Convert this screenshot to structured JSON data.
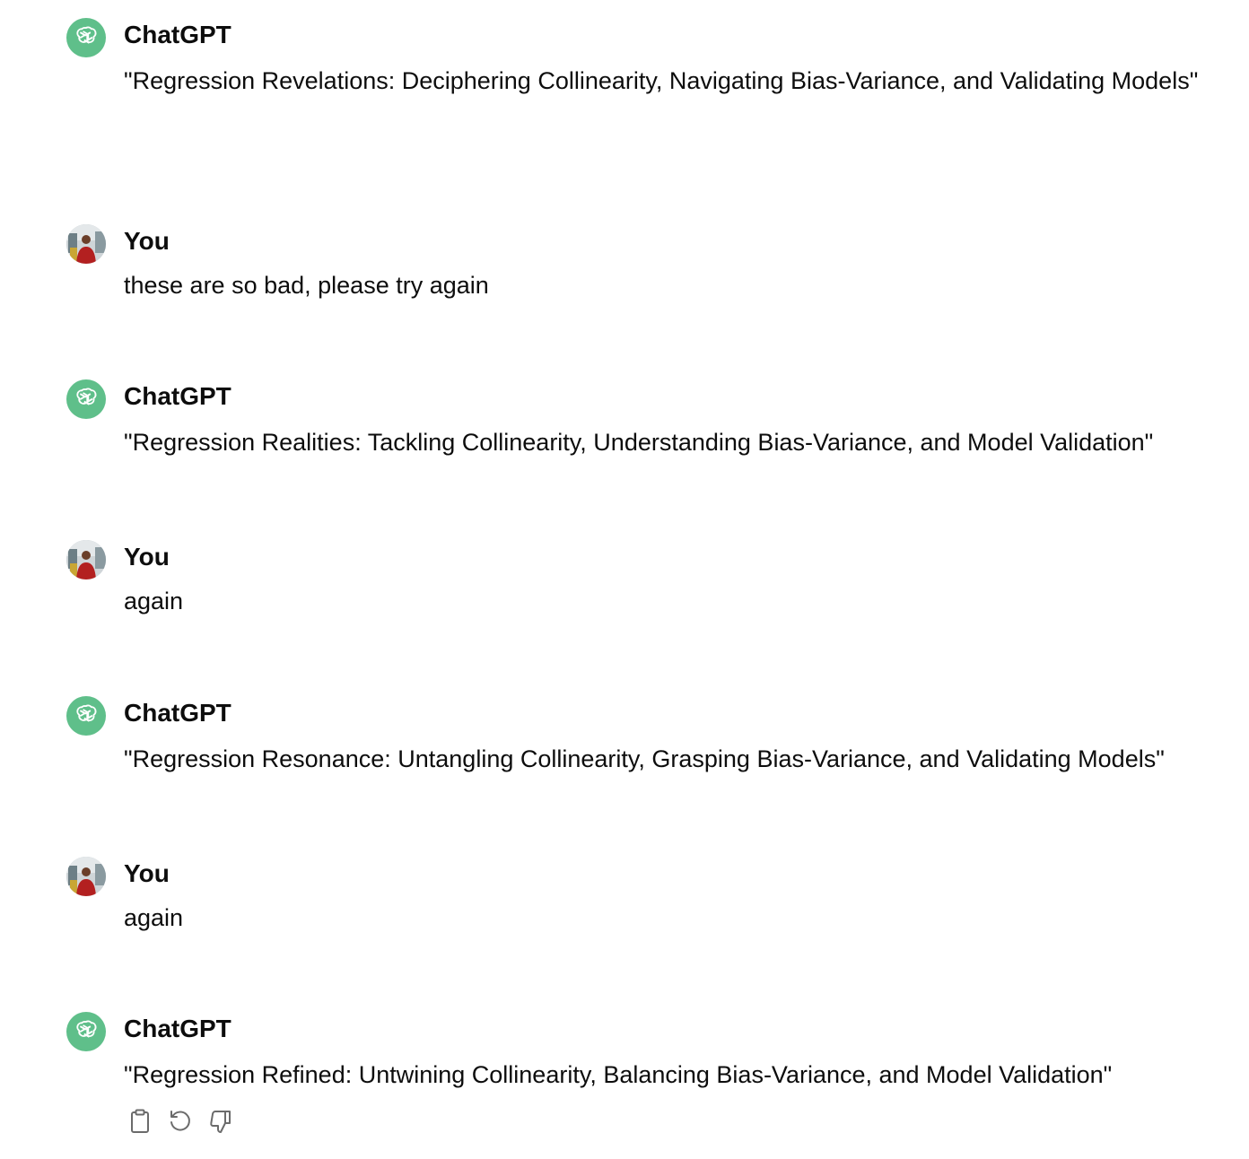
{
  "messages": [
    {
      "role": "assistant",
      "author": "ChatGPT",
      "text": "\"Regression Revelations: Deciphering Collinearity, Navigating Bias-Variance, and Validating Models\""
    },
    {
      "role": "user",
      "author": "You",
      "text": "these are so bad, please try again"
    },
    {
      "role": "assistant",
      "author": "ChatGPT",
      "text": "\"Regression Realities: Tackling Collinearity, Understanding Bias-Variance, and Model Validation\""
    },
    {
      "role": "user",
      "author": "You",
      "text": "again"
    },
    {
      "role": "assistant",
      "author": "ChatGPT",
      "text": "\"Regression Resonance: Untangling Collinearity, Grasping Bias-Variance, and Validating Models\""
    },
    {
      "role": "user",
      "author": "You",
      "text": "again"
    },
    {
      "role": "assistant",
      "author": "ChatGPT",
      "text": "\"Regression Refined: Untwining Collinearity, Balancing Bias-Variance, and Model Validation\""
    }
  ],
  "actions": [
    {
      "icon": "clipboard-icon"
    },
    {
      "icon": "regenerate-icon"
    },
    {
      "icon": "thumbs-down-icon"
    }
  ],
  "colors": {
    "assistant_avatar": "#5fbf8a",
    "text": "#0d0d0d",
    "icon": "#6b6b6b"
  }
}
